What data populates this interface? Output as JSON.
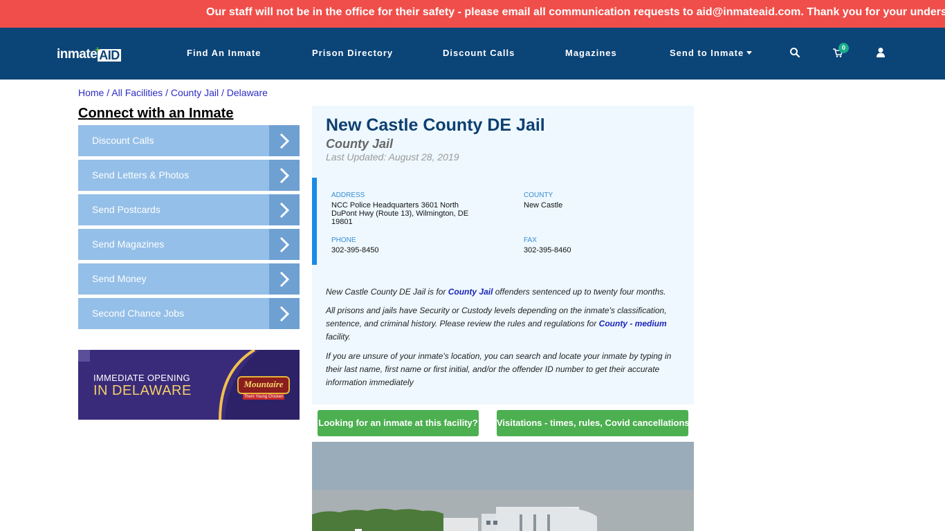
{
  "alert": {
    "text": "Our staff will not be in the office for their safety - please email all communication requests to aid@inmateaid.com. Thank you for your understanding."
  },
  "navbar": {
    "logo": {
      "part1": "inmate",
      "part2": "AID",
      "plus": "+"
    },
    "items": [
      {
        "label": "Find An Inmate"
      },
      {
        "label": "Prison Directory"
      },
      {
        "label": "Discount Calls"
      },
      {
        "label": "Magazines"
      },
      {
        "label": "Send to Inmate",
        "has_dropdown": true
      }
    ],
    "icons": {
      "search": "search-icon",
      "cart": "cart-icon",
      "user": "user-icon"
    },
    "cart_count": "0"
  },
  "breadcrumb": [
    {
      "label": "Home"
    },
    {
      "label": "All Facilities"
    },
    {
      "label": "County Jail"
    },
    {
      "label": "Delaware"
    }
  ],
  "breadcrumb_separator": "/",
  "sidebar": {
    "title": "Connect with an Inmate",
    "items": [
      {
        "label": "Discount Calls"
      },
      {
        "label": "Send Letters & Photos"
      },
      {
        "label": "Send Postcards"
      },
      {
        "label": "Send Magazines"
      },
      {
        "label": "Send Money"
      },
      {
        "label": "Second Chance Jobs"
      }
    ],
    "ad": {
      "line1": "IMMEDIATE OPENING",
      "line2": "IN DELAWARE",
      "brand": "Mountaire",
      "brand_sub": "Them Young Chicken"
    }
  },
  "facility": {
    "title": "New Castle County DE Jail",
    "type": "County Jail",
    "last_updated": "Last Updated: August 28, 2019",
    "address_label": "ADDRESS",
    "address": "NCC Police Headquarters 3601 North DuPont Hwy (Route 13), Wilmington, DE 19801",
    "county_label": "COUNTY",
    "county": "New Castle",
    "phone_label": "PHONE",
    "phone": "302-395-8450",
    "fax_label": "FAX",
    "fax": "302-395-8460",
    "desc1_pre": "New Castle County DE Jail is for ",
    "desc1_link": "County Jail",
    "desc1_post": " offenders sentenced up to twenty four months.",
    "desc2_pre": "All prisons and jails have Security or Custody levels depending on the inmate's classification, sentence, and criminal history. Please review the rules and regulations for ",
    "desc2_link": "County - medium",
    "desc2_post": " facility.",
    "desc3": "If you are unsure of your inmate's location, you can search and locate your inmate by typing in their last name, first name or first initial, and/or the offender ID number to get their accurate information immediately"
  },
  "buttons": {
    "find_inmate": "Looking for an inmate at this facility?",
    "visitations": "Visitations - times, rules, Covid cancellations"
  },
  "colors": {
    "alert_bg": "#f04e4a",
    "nav_bg": "#0b4477",
    "sidebar_btn": "#94bfe8",
    "sidebar_arrow": "#6fa0d2",
    "card_bg": "#eef8fe",
    "accent_blue": "#1a8ae6",
    "green_btn": "#4caf50",
    "title_blue": "#0d3f70"
  }
}
